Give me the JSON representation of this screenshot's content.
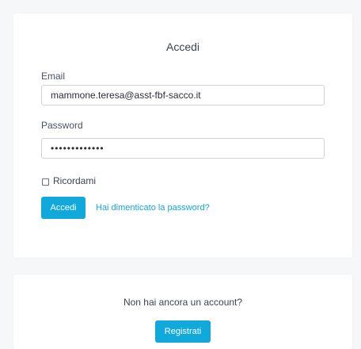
{
  "login": {
    "title": "Accedi",
    "email_label": "Email",
    "email_value": "mammone.teresa@asst-fbf-sacco.it",
    "password_label": "Password",
    "password_value": "•••••••••••••",
    "remember_label": "Ricordami",
    "remember_checked": false,
    "submit_label": "Accedi",
    "forgot_label": "Hai dimenticato la password?"
  },
  "register": {
    "prompt": "Non hai ancora un account?",
    "button_label": "Registrati"
  },
  "colors": {
    "accent": "#11a8dc",
    "background": "#f6f7f9",
    "card": "#ffffff"
  }
}
